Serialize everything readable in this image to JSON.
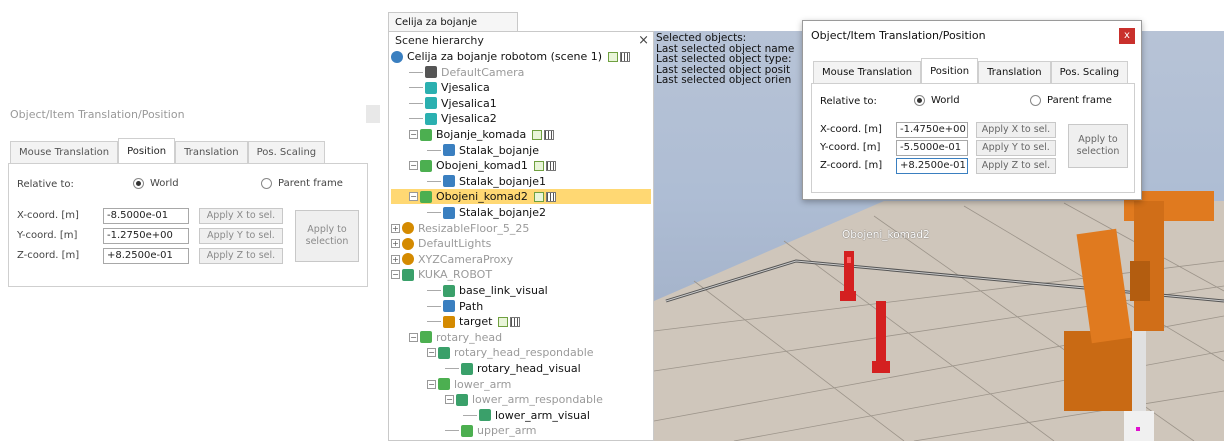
{
  "dialog": {
    "title": "Object/Item Translation/Position",
    "tabs": [
      "Mouse Translation",
      "Position",
      "Translation",
      "Pos. Scaling"
    ],
    "active_tab": "Position",
    "relative_to_label": "Relative to:",
    "radio_world": "World",
    "radio_parent": "Parent frame",
    "x_label": "X-coord. [m]",
    "y_label": "Y-coord. [m]",
    "z_label": "Z-coord. [m]",
    "apply_x": "Apply X to sel.",
    "apply_y": "Apply Y to sel.",
    "apply_z": "Apply Z to sel.",
    "apply_sel": "Apply to selection",
    "close_glyph": "x"
  },
  "left_dialog_values": {
    "x": "-8.5000e-01",
    "y": "-1.2750e+00",
    "z": "+8.2500e-01"
  },
  "right_dialog_values": {
    "x": "-1.4750e+00",
    "y": "-5.5000e-01",
    "z": "+8.2500e-01"
  },
  "app": {
    "tab_title": "Celija za bojanje robotom",
    "hierarchy_title": "Scene hierarchy",
    "hierarchy_close": "×",
    "tree": [
      {
        "label": "Celija za bojanje robotom (scene 1)",
        "style": "dark",
        "indent": 0,
        "icon": "scene-icon",
        "icon_color": "#3a7fc0"
      },
      {
        "label": "DefaultCamera",
        "style": "dim",
        "indent": 1,
        "icon": "camera-icon",
        "icon_color": "#555"
      },
      {
        "label": "Vjesalica",
        "style": "dark",
        "indent": 1,
        "icon": "cuboid-icon",
        "icon_color": "#2bb0b0"
      },
      {
        "label": "Vjesalica1",
        "style": "dark",
        "indent": 1,
        "icon": "cuboid-icon",
        "icon_color": "#2bb0b0"
      },
      {
        "label": "Vjesalica2",
        "style": "dark",
        "indent": 1,
        "icon": "cuboid-icon",
        "icon_color": "#2bb0b0"
      },
      {
        "label": "Bojanje_komada",
        "style": "dark",
        "indent": 1,
        "icon": "paint-icon",
        "icon_color": "#4caf50"
      },
      {
        "label": "Stalak_bojanje",
        "style": "dark",
        "indent": 2,
        "icon": "shape-icon",
        "icon_color": "#3a7fc0"
      },
      {
        "label": "Obojeni_komad1",
        "style": "dark",
        "indent": 1,
        "icon": "paint-icon",
        "icon_color": "#4caf50"
      },
      {
        "label": "Stalak_bojanje1",
        "style": "dark",
        "indent": 2,
        "icon": "shape-icon",
        "icon_color": "#3a7fc0"
      },
      {
        "label": "Obojeni_komad2",
        "style": "dark",
        "indent": 1,
        "icon": "paint-icon",
        "icon_color": "#4caf50"
      },
      {
        "label": "Stalak_bojanje2",
        "style": "dark",
        "indent": 2,
        "icon": "shape-icon",
        "icon_color": "#3a7fc0"
      },
      {
        "label": "ResizableFloor_5_25",
        "style": "dim",
        "indent": 0,
        "icon": "model-icon",
        "icon_color": "#d48a00"
      },
      {
        "label": "DefaultLights",
        "style": "dim",
        "indent": 0,
        "icon": "model-icon",
        "icon_color": "#d48a00"
      },
      {
        "label": "XYZCameraProxy",
        "style": "dim",
        "indent": 0,
        "icon": "model-icon",
        "icon_color": "#d48a00"
      },
      {
        "label": "KUKA_ROBOT",
        "style": "dim",
        "indent": 0,
        "icon": "robot-icon",
        "icon_color": "#3aa06a"
      },
      {
        "label": "base_link_visual",
        "style": "dark",
        "indent": 2,
        "icon": "mesh-icon",
        "icon_color": "#3aa06a"
      },
      {
        "label": "Path",
        "style": "dark",
        "indent": 2,
        "icon": "path-icon",
        "icon_color": "#3a7fc0"
      },
      {
        "label": "target",
        "style": "dark",
        "indent": 2,
        "icon": "dummy-icon",
        "icon_color": "#d48a00"
      },
      {
        "label": "rotary_head",
        "style": "dim",
        "indent": 1,
        "icon": "joint-icon",
        "icon_color": "#4caf50"
      },
      {
        "label": "rotary_head_respondable",
        "style": "dim",
        "indent": 2,
        "icon": "mesh-icon",
        "icon_color": "#3aa06a"
      },
      {
        "label": "rotary_head_visual",
        "style": "dark",
        "indent": 3,
        "icon": "mesh-icon",
        "icon_color": "#3aa06a"
      },
      {
        "label": "lower_arm",
        "style": "dim",
        "indent": 2,
        "icon": "joint-icon",
        "icon_color": "#4caf50"
      },
      {
        "label": "lower_arm_respondable",
        "style": "dim",
        "indent": 3,
        "icon": "mesh-icon",
        "icon_color": "#3aa06a"
      },
      {
        "label": "lower_arm_visual",
        "style": "dark",
        "indent": 4,
        "icon": "mesh-icon",
        "icon_color": "#3aa06a"
      },
      {
        "label": "upper_arm",
        "style": "dim",
        "indent": 3,
        "icon": "joint-icon",
        "icon_color": "#4caf50"
      }
    ],
    "selected_item": "Obojeni_komad2",
    "viewport_info": [
      "Selected objects:",
      "Last selected object name",
      "Last selected object type:",
      "Last selected object posit",
      "Last selected object orien"
    ],
    "object_label": "Obojeni_komad2",
    "colors": {
      "selection": "#ffd873",
      "robot": "#e07a1f",
      "piece": "#d42020",
      "close": "#c9302c"
    }
  }
}
